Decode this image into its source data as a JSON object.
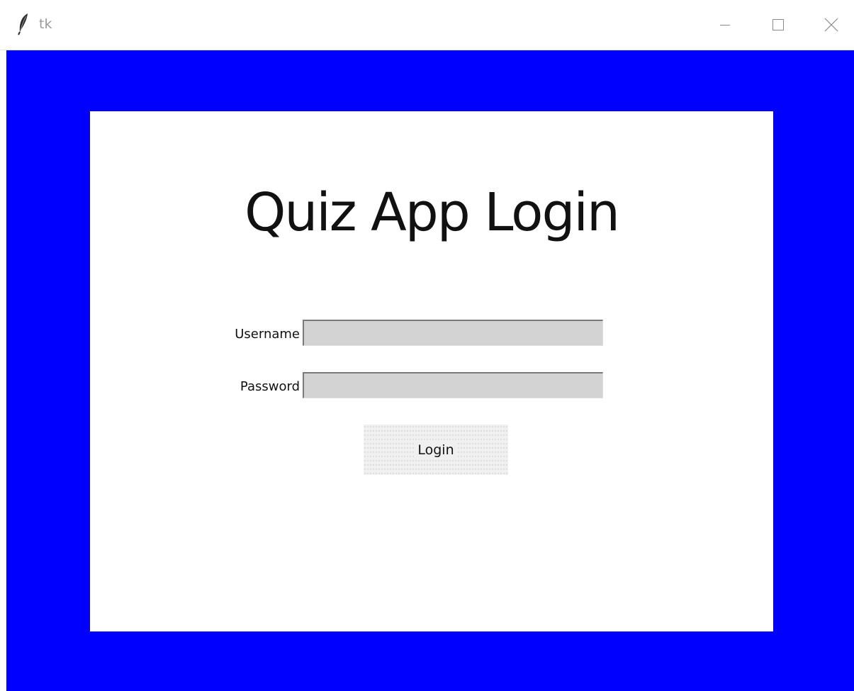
{
  "window": {
    "title": "tk",
    "controls": {
      "minimize_icon": "minimize-icon",
      "maximize_icon": "maximize-icon",
      "close_icon": "close-icon"
    },
    "app_icon": "feather-icon"
  },
  "colors": {
    "background": "#0000fe",
    "panel": "#ffffff",
    "input_fill": "#d3d3d3",
    "button_fill": "#f0f0f0"
  },
  "login": {
    "heading": "Quiz App Login",
    "username_label": "Username",
    "username_value": "",
    "password_label": "Password",
    "password_value": "",
    "button_label": "Login"
  }
}
